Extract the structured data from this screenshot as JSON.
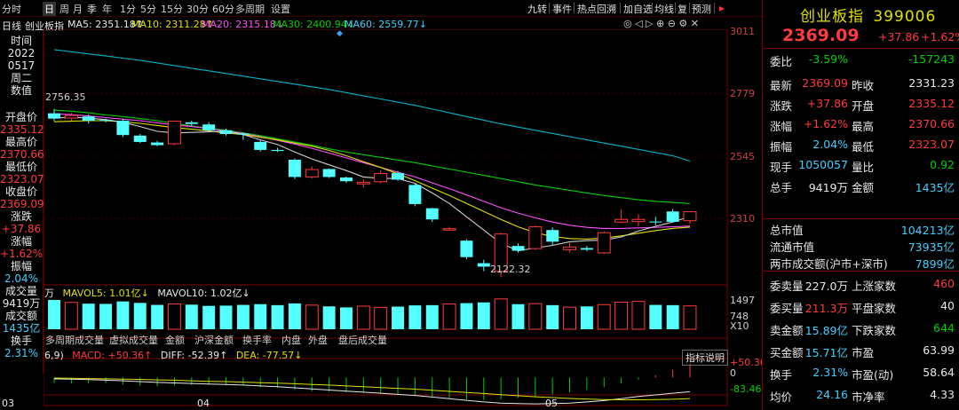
{
  "toolbar": {
    "items": [
      "分时",
      "日",
      "周",
      "月",
      "季",
      "年",
      "1分",
      "5分",
      "15分",
      "30分",
      "60分",
      "多周期",
      "设置"
    ],
    "active_index": 1,
    "right_buttons": [
      "九转",
      "事件",
      "热点回溯",
      "加自选",
      "均线",
      "复",
      "预测"
    ]
  },
  "ma_line": {
    "chart_type": "日线",
    "name": "创业板指",
    "ma5": "MA5: 2351.18↑",
    "ma10": "MA10: 2311.28↑",
    "ma20": "MA20: 2315.18↓",
    "ma30": "MA30: 2400.94↓",
    "ma60": "MA60: 2559.77↓"
  },
  "left_panel": {
    "time_label": "时间",
    "year": "2022",
    "date": "0517",
    "weekday": "周二",
    "value_label": "数值",
    "open_label": "开盘价",
    "open": "2335.12",
    "high_label": "最高价",
    "high": "2370.66",
    "low_label": "最低价",
    "low": "2323.07",
    "close_label": "收盘价",
    "close": "2369.09",
    "change_label": "涨跌",
    "change": "+37.86",
    "pct_label": "涨幅",
    "pct": "+1.62%",
    "amp_label": "振幅",
    "amp": "2.04%",
    "vol_label": "成交量",
    "vol": "9419万",
    "amount_label": "成交额",
    "amount": "1435亿",
    "turnover_label": "换手",
    "turnover": "2.31%"
  },
  "price_axis": [
    "3011",
    "2779",
    "2545",
    "2310"
  ],
  "price_annotations": {
    "high": "2756.35",
    "low": "2122.32"
  },
  "volume_axis": {
    "top": "1497",
    "mid": "748",
    "unit": "X10"
  },
  "volume_line": {
    "prefix": "万",
    "mavol5": "MAVOL5: 1.01亿↓",
    "mavol10": "MAVOL10: 1.02亿↓"
  },
  "indicator_tabs": [
    "多周期成交量",
    "虚拟成交量",
    "金额",
    "沪深金额",
    "换手率",
    "内盘",
    "外盘",
    "盘后成交量"
  ],
  "macd_line": {
    "params": "6,9)",
    "macd": "MACD: +50.36↑",
    "diff": "DIFF: -52.39↑",
    "dea": "DEA: -77.57↓",
    "help": "指标说明"
  },
  "macd_axis": {
    "top": "+50.36",
    "zero": "0",
    "bottom": "-83.46"
  },
  "x_axis": [
    "03",
    "04",
    "05"
  ],
  "chart_data": {
    "type": "candlestick",
    "title": "创业板指 日线",
    "ylim": [
      2100,
      3050
    ],
    "price_ticks": [
      3011,
      2779,
      2545,
      2310
    ],
    "x_ticks": [
      "03",
      "04",
      "05"
    ],
    "candles": [
      {
        "o": 2740,
        "c": 2720,
        "h": 2756.35,
        "l": 2710
      },
      {
        "o": 2722,
        "c": 2732,
        "h": 2742,
        "l": 2712
      },
      {
        "o": 2728,
        "c": 2712,
        "h": 2736,
        "l": 2702
      },
      {
        "o": 2715,
        "c": 2712,
        "h": 2720,
        "l": 2706
      },
      {
        "o": 2712,
        "c": 2658,
        "h": 2720,
        "l": 2650
      },
      {
        "o": 2656,
        "c": 2632,
        "h": 2662,
        "l": 2628
      },
      {
        "o": 2630,
        "c": 2620,
        "h": 2636,
        "l": 2616
      },
      {
        "o": 2625,
        "c": 2710,
        "h": 2712,
        "l": 2620
      },
      {
        "o": 2706,
        "c": 2700,
        "h": 2712,
        "l": 2692
      },
      {
        "o": 2698,
        "c": 2676,
        "h": 2706,
        "l": 2670
      },
      {
        "o": 2676,
        "c": 2662,
        "h": 2682,
        "l": 2656
      },
      {
        "o": 2664,
        "c": 2660,
        "h": 2668,
        "l": 2640
      },
      {
        "o": 2632,
        "c": 2602,
        "h": 2638,
        "l": 2596
      },
      {
        "o": 2602,
        "c": 2598,
        "h": 2610,
        "l": 2594
      },
      {
        "o": 2565,
        "c": 2500,
        "h": 2570,
        "l": 2492
      },
      {
        "o": 2500,
        "c": 2528,
        "h": 2540,
        "l": 2495
      },
      {
        "o": 2530,
        "c": 2500,
        "h": 2532,
        "l": 2496
      },
      {
        "o": 2498,
        "c": 2484,
        "h": 2502,
        "l": 2478
      },
      {
        "o": 2474,
        "c": 2480,
        "h": 2492,
        "l": 2460
      },
      {
        "o": 2482,
        "c": 2513,
        "h": 2525,
        "l": 2476
      },
      {
        "o": 2515,
        "c": 2490,
        "h": 2522,
        "l": 2486
      },
      {
        "o": 2470,
        "c": 2398,
        "h": 2474,
        "l": 2390
      },
      {
        "o": 2382,
        "c": 2340,
        "h": 2384,
        "l": 2330
      },
      {
        "o": 2300,
        "c": 2305,
        "h": 2312,
        "l": 2298
      },
      {
        "o": 2260,
        "c": 2198,
        "h": 2265,
        "l": 2190
      },
      {
        "o": 2175,
        "c": 2162,
        "h": 2188,
        "l": 2145
      },
      {
        "o": 2144,
        "c": 2285,
        "h": 2290,
        "l": 2122.32
      },
      {
        "o": 2240,
        "c": 2222,
        "h": 2250,
        "l": 2215
      },
      {
        "o": 2230,
        "c": 2312,
        "h": 2318,
        "l": 2225
      },
      {
        "o": 2300,
        "c": 2256,
        "h": 2310,
        "l": 2240
      },
      {
        "o": 2226,
        "c": 2236,
        "h": 2252,
        "l": 2216
      },
      {
        "o": 2232,
        "c": 2226,
        "h": 2240,
        "l": 2220
      },
      {
        "o": 2214,
        "c": 2290,
        "h": 2295,
        "l": 2210
      },
      {
        "o": 2330,
        "c": 2340,
        "h": 2378,
        "l": 2326
      },
      {
        "o": 2332,
        "c": 2340,
        "h": 2360,
        "l": 2314
      },
      {
        "o": 2332,
        "c": 2330,
        "h": 2350,
        "l": 2318
      },
      {
        "o": 2370,
        "c": 2331,
        "h": 2380,
        "l": 2328
      },
      {
        "o": 2335.12,
        "c": 2369.09,
        "h": 2370.66,
        "l": 2323.07
      }
    ],
    "series": [
      {
        "name": "MA60",
        "color": "#00b4c8",
        "values": [
          2980,
          2972,
          2964,
          2956,
          2948,
          2940,
          2930,
          2920,
          2910,
          2900,
          2890,
          2880,
          2870,
          2860,
          2850,
          2840,
          2830,
          2818,
          2806,
          2794,
          2782,
          2770,
          2756,
          2742,
          2728,
          2714,
          2700,
          2688,
          2676,
          2664,
          2652,
          2640,
          2628,
          2616,
          2604,
          2592,
          2580,
          2560
        ]
      },
      {
        "name": "MA30",
        "color": "#00d000",
        "values": [
          2752,
          2748,
          2742,
          2734,
          2728,
          2720,
          2712,
          2702,
          2692,
          2684,
          2676,
          2666,
          2656,
          2644,
          2632,
          2620,
          2606,
          2594,
          2584,
          2574,
          2564,
          2554,
          2542,
          2530,
          2518,
          2506,
          2494,
          2482,
          2470,
          2460,
          2450,
          2440,
          2430,
          2422,
          2414,
          2408,
          2404,
          2400
        ]
      },
      {
        "name": "MA20",
        "color": "#ff50ff",
        "values": [
          2738,
          2735,
          2730,
          2724,
          2718,
          2712,
          2704,
          2696,
          2690,
          2682,
          2674,
          2664,
          2652,
          2638,
          2624,
          2608,
          2590,
          2572,
          2554,
          2536,
          2518,
          2500,
          2478,
          2456,
          2432,
          2408,
          2384,
          2364,
          2346,
          2330,
          2318,
          2310,
          2306,
          2306,
          2308,
          2310,
          2312,
          2315
        ]
      },
      {
        "name": "MA10",
        "color": "#e0e000",
        "values": [
          2708,
          2710,
          2712,
          2712,
          2708,
          2702,
          2694,
          2686,
          2680,
          2674,
          2666,
          2660,
          2650,
          2640,
          2628,
          2616,
          2600,
          2580,
          2558,
          2536,
          2512,
          2486,
          2458,
          2430,
          2400,
          2370,
          2340,
          2312,
          2290,
          2276,
          2268,
          2266,
          2270,
          2278,
          2288,
          2298,
          2306,
          2311
        ]
      },
      {
        "name": "MA5",
        "color": "#d0d0d0",
        "values": [
          2722,
          2726,
          2722,
          2716,
          2706,
          2690,
          2672,
          2666,
          2668,
          2670,
          2674,
          2660,
          2640,
          2622,
          2594,
          2568,
          2546,
          2524,
          2500,
          2495,
          2494,
          2476,
          2440,
          2400,
          2350,
          2300,
          2250,
          2222,
          2232,
          2242,
          2256,
          2260,
          2262,
          2274,
          2296,
          2314,
          2330,
          2351
        ]
      }
    ],
    "volume": [
      1.18,
      1.08,
      1.03,
      1.02,
      1.12,
      1.06,
      0.98,
      1.02,
      0.99,
      0.94,
      0.95,
      0.98,
      1.01,
      0.97,
      1.04,
      0.97,
      0.92,
      0.88,
      0.93,
      0.88,
      0.91,
      0.96,
      0.97,
      1.02,
      1.05,
      1.08,
      1.22,
      1.01,
      1.03,
      0.97,
      0.89,
      0.92,
      0.99,
      1.09,
      1.12,
      0.98,
      0.97,
      0.94
    ],
    "volume_ylim": [
      0,
      1.5
    ],
    "macd": [
      -20,
      -22,
      -22,
      -20,
      -26,
      -30,
      -32,
      -30,
      -28,
      -27,
      -28,
      -30,
      -35,
      -38,
      -45,
      -50,
      -52,
      -54,
      -56,
      -58,
      -60,
      -64,
      -70,
      -75,
      -80,
      -83,
      -80,
      -75,
      -70,
      -62,
      -54,
      -46,
      -36,
      -22,
      -8,
      8,
      28,
      50.36
    ],
    "diff": [
      -5,
      -6,
      -8,
      -10,
      -12,
      -15,
      -18,
      -20,
      -22,
      -24,
      -26,
      -28,
      -31,
      -34,
      -38,
      -42,
      -46,
      -50,
      -54,
      -58,
      -62,
      -66,
      -72,
      -78,
      -84,
      -90,
      -94,
      -96,
      -97,
      -96,
      -94,
      -90,
      -85,
      -78,
      -70,
      -64,
      -58,
      -52.39
    ],
    "dea": [
      -2,
      -3,
      -4,
      -5,
      -6,
      -7,
      -9,
      -10,
      -12,
      -14,
      -15,
      -17,
      -19,
      -21,
      -23,
      -26,
      -28,
      -31,
      -34,
      -37,
      -40,
      -43,
      -47,
      -51,
      -55,
      -59,
      -63,
      -67,
      -71,
      -74,
      -77,
      -79,
      -81,
      -82,
      -82,
      -81,
      -80,
      -77.57
    ],
    "macd_ylim": [
      -100,
      60
    ]
  },
  "right_panel": {
    "title": "创业板指",
    "code": "399006",
    "price": "2369.09",
    "change": "+37.86",
    "pct": "+1.62%",
    "rows": [
      {
        "l1": "委比",
        "v1": "-3.59%",
        "c1": "green",
        "l2": "",
        "v2": "-157243",
        "c2": "green"
      },
      {
        "l1": "最新",
        "v1": "2369.09",
        "c1": "red",
        "l2": "昨收",
        "v2": "2331.23",
        "c2": "white"
      },
      {
        "l1": "涨跌",
        "v1": "+37.86",
        "c1": "red",
        "l2": "开盘",
        "v2": "2335.12",
        "c2": "red"
      },
      {
        "l1": "涨幅",
        "v1": "+1.62%",
        "c1": "red",
        "l2": "最高",
        "v2": "2370.66",
        "c2": "red"
      },
      {
        "l1": "振幅",
        "v1": "2.04%",
        "c1": "cyan",
        "l2": "最低",
        "v2": "2323.07",
        "c2": "red"
      },
      {
        "l1": "现手",
        "v1": "1050057",
        "c1": "cyan",
        "l2": "量比",
        "v2": "0.92",
        "c2": "green"
      },
      {
        "l1": "总手",
        "v1": "9419万",
        "c1": "white",
        "l2": "金额",
        "v2": "1435亿",
        "c2": "cyan"
      }
    ],
    "cap_rows": [
      {
        "label": "总市值",
        "value": "104213亿"
      },
      {
        "label": "流通市值",
        "value": "73935亿"
      },
      {
        "label": "两市成交额(沪市+深市)",
        "value": "7899亿"
      }
    ],
    "bottom_rows": [
      {
        "l1": "委卖量",
        "v1": "227.0万",
        "c1": "white",
        "l2": "上涨家数",
        "v2": "460",
        "c2": "red"
      },
      {
        "l1": "委买量",
        "v1": "211.3万",
        "c1": "red",
        "l2": "平盘家数",
        "v2": "40",
        "c2": "white"
      },
      {
        "l1": "卖金额",
        "v1": "15.89亿",
        "c1": "cyan",
        "l2": "下跌家数",
        "v2": "644",
        "c2": "green"
      },
      {
        "l1": "买金额",
        "v1": "15.71亿",
        "c1": "cyan",
        "l2": "市盈",
        "v2": "63.99",
        "c2": "white"
      },
      {
        "l1": "换手",
        "v1": "2.31%",
        "c1": "cyan",
        "l2": "市盈(动)",
        "v2": "58.64",
        "c2": "white"
      },
      {
        "l1": "均价",
        "v1": "24.16",
        "c1": "cyan",
        "l2": "市净率",
        "v2": "4.33",
        "c2": "white"
      }
    ]
  }
}
